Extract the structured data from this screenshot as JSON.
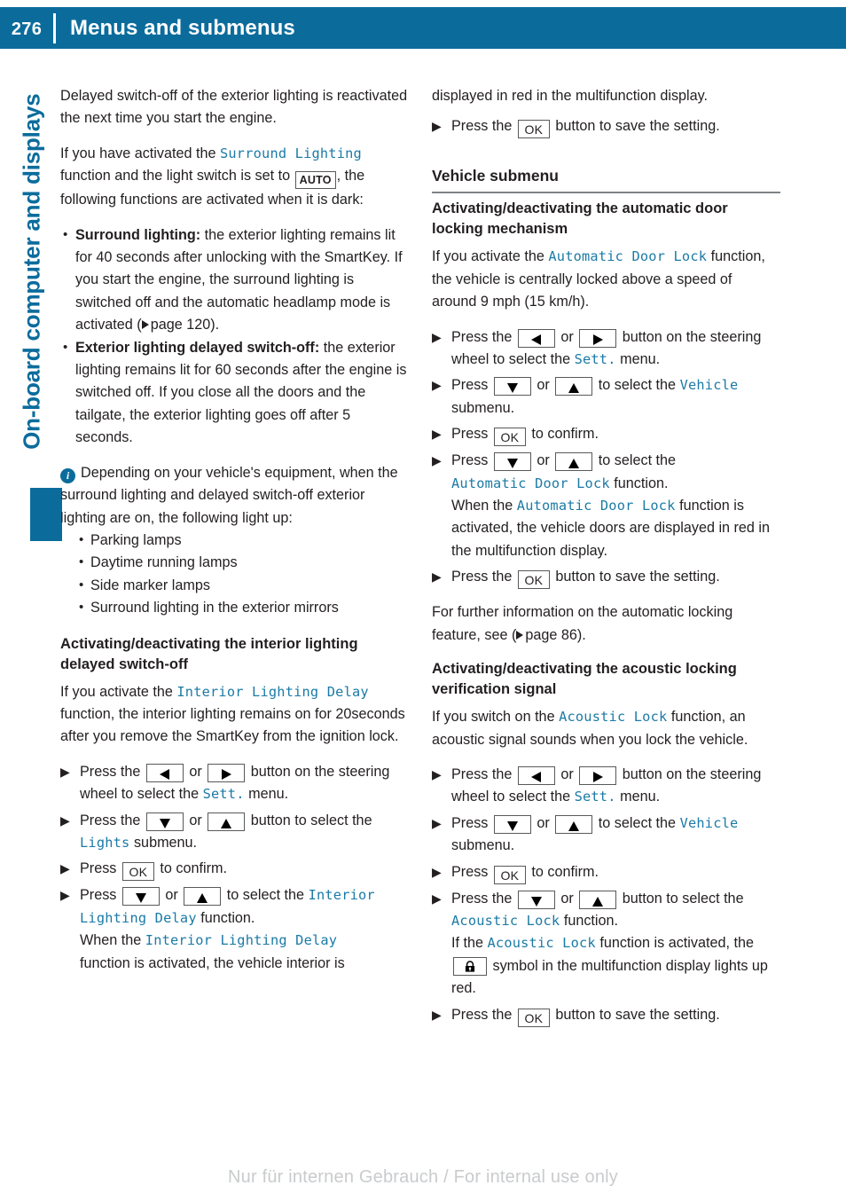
{
  "header": {
    "page_number": "276",
    "title": "Menus and submenus",
    "background_color": "#0b6c9c"
  },
  "chapter_tab": {
    "label": "On-board computer and displays",
    "color": "#0b6c9c"
  },
  "colors": {
    "accent_blue": "#0b6c9c",
    "code_blue": "#1b7aa6",
    "body_text": "#231f20",
    "rule_gray": "#808285",
    "watermark_gray": "#c9cbcd"
  },
  "left_column": {
    "para_1": "Delayed switch-off of the exterior lighting is reactivated the next time you start the engine.",
    "para_2_a": "If you have activated the ",
    "para_2_code_1": "Surround Lighting",
    "para_2_b": " function and the light switch is set to ",
    "para_2_key": "AUTO",
    "para_2_c": ", the following functions are activated when it is dark:",
    "bullets": [
      {
        "lead": "Surround lighting:",
        "text": " the exterior lighting remains lit for 40 seconds after unlocking with the SmartKey. If you start the engine, the surround lighting is switched off and the automatic headlamp mode is activated (",
        "xref": "page 120",
        "tail": ")."
      },
      {
        "lead": "Exterior lighting delayed switch-off:",
        "text": " the exterior lighting remains lit for 60 seconds after the engine is switched off. If you close all the doors and the tailgate, the exterior lighting goes off after 5 seconds.",
        "xref": "",
        "tail": ""
      }
    ],
    "note": {
      "icon": "info-icon",
      "text": "Depending on your vehicle's equipment, when the surround lighting and delayed switch-off exterior lighting are on, the following light up:",
      "items": [
        "Parking lamps",
        "Daytime running lamps",
        "Side marker lamps",
        "Surround lighting in the exterior mirrors"
      ]
    },
    "subheading": "Activating/deactivating the interior lighting delayed switch-off",
    "para_3_a": "If you activate the ",
    "para_3_code": "Interior Lighting Delay",
    "para_3_b": " function, the interior lighting remains on for 20seconds after you remove the SmartKey from the ignition lock.",
    "steps": [
      {
        "a": "Press the ",
        "key1": "left-arrow-key",
        "mid": " or ",
        "key2": "right-arrow-key",
        "b": " button on the steering wheel to select the ",
        "code": "Sett.",
        "c": " menu."
      },
      {
        "a": "Press the ",
        "key1": "down-arrow-key",
        "mid": " or ",
        "key2": "up-arrow-key",
        "b": " button to select the ",
        "code": "Lights",
        "c": " submenu."
      },
      {
        "a": "Press ",
        "key1": "ok-key",
        "mid": "",
        "key2": "",
        "b": " to confirm.",
        "code": "",
        "c": ""
      },
      {
        "a": "Press ",
        "key1": "down-arrow-key",
        "mid": " or ",
        "key2": "up-arrow-key",
        "b": " to select the ",
        "code": "Interior Lighting Delay",
        "c": " function."
      }
    ],
    "step_4_extra_a": "When the ",
    "step_4_extra_code": "Interior Lighting Delay",
    "step_4_extra_b": " function is activated, the vehicle interior is"
  },
  "right_column": {
    "para_continue": "displayed in red in the multifunction display.",
    "step_save_1": {
      "a": "Press the ",
      "key": "ok-key",
      "b": " button to save the setting."
    },
    "section_heading": "Vehicle submenu",
    "sub_1": {
      "heading": "Activating/deactivating the automatic door locking mechanism",
      "intro_a": "If you activate the ",
      "intro_code": "Automatic Door Lock",
      "intro_b": " function, the vehicle is centrally locked above a speed of around 9 mph (15 km/h).",
      "steps": [
        {
          "a": "Press the ",
          "key1": "left-arrow-key",
          "mid": " or ",
          "key2": "right-arrow-key",
          "b": " button on the steering wheel to select the ",
          "code": "Sett.",
          "c": " menu."
        },
        {
          "a": "Press ",
          "key1": "down-arrow-key",
          "mid": " or ",
          "key2": "up-arrow-key",
          "b": " to select the ",
          "code": "Vehicle",
          "c": " submenu."
        },
        {
          "a": "Press ",
          "key1": "ok-key",
          "mid": "",
          "key2": "",
          "b": " to confirm.",
          "code": "",
          "c": ""
        },
        {
          "a": "Press ",
          "key1": "down-arrow-key",
          "mid": " or ",
          "key2": "up-arrow-key",
          "b": " to select the ",
          "code": "Automatic Door Lock",
          "c": " function."
        }
      ],
      "step_4_extra_a": "When the ",
      "step_4_extra_code": "Automatic Door Lock",
      "step_4_extra_b": " function is activated, the vehicle doors are displayed in red in the multifunction display.",
      "step_save": {
        "a": "Press the ",
        "key": "ok-key",
        "b": " button to save the setting."
      },
      "closing_a": "For further information on the automatic locking feature, see (",
      "closing_xref": "page 86",
      "closing_b": ")."
    },
    "sub_2": {
      "heading": "Activating/deactivating the acoustic locking verification signal",
      "intro_a": "If you switch on the ",
      "intro_code": "Acoustic Lock",
      "intro_b": " function, an acoustic signal sounds when you lock the vehicle.",
      "steps": [
        {
          "a": "Press the ",
          "key1": "left-arrow-key",
          "mid": " or ",
          "key2": "right-arrow-key",
          "b": " button on the steering wheel to select the ",
          "code": "Sett.",
          "c": " menu."
        },
        {
          "a": "Press ",
          "key1": "down-arrow-key",
          "mid": " or ",
          "key2": "up-arrow-key",
          "b": " to select the ",
          "code": "Vehicle",
          "c": " submenu."
        },
        {
          "a": "Press ",
          "key1": "ok-key",
          "mid": "",
          "key2": "",
          "b": " to confirm.",
          "code": "",
          "c": ""
        },
        {
          "a": "Press the ",
          "key1": "down-arrow-key",
          "mid": " or ",
          "key2": "up-arrow-key",
          "b": " button to select the ",
          "code": "Acoustic Lock",
          "c": " function."
        }
      ],
      "step_4_extra_a": "If the ",
      "step_4_extra_code": "Acoustic Lock",
      "step_4_extra_b": " function is activated, the ",
      "step_4_extra_key": "lock-symbol-key",
      "step_4_extra_c": " symbol in the multifunction display lights up red.",
      "step_save": {
        "a": "Press the ",
        "key": "ok-key",
        "b": " button to save the setting."
      }
    }
  },
  "footer": {
    "watermark": "Nur für internen Gebrauch / For internal use only"
  }
}
